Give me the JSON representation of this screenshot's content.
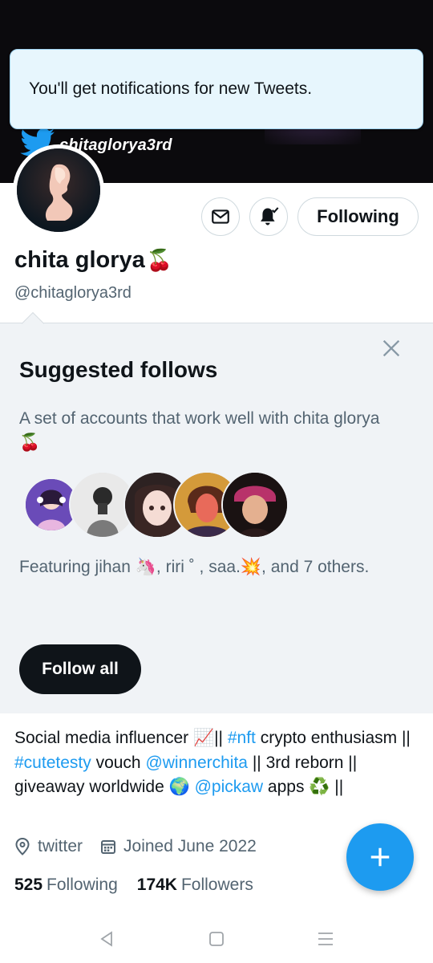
{
  "banner": {
    "handle_text": "chitaglorya3rd",
    "bird_color": "#1d9bf0"
  },
  "toast": {
    "message": "You'll get notifications for new Tweets."
  },
  "profile": {
    "name": "chita glorya",
    "name_emoji": "🍒",
    "handle": "@chitaglorya3rd",
    "following_button": "Following",
    "message_icon": "envelope-icon",
    "notifications_icon": "bell-check-icon"
  },
  "suggested": {
    "title": "Suggested follows",
    "description": "A set of accounts that work well with chita glorya🍒",
    "featuring": "Featuring jihan 🦄, riri ˚ , saa.💥, and 7 others.",
    "follow_all": "Follow all",
    "close_icon": "close-icon"
  },
  "bio": {
    "part1": "Social media influencer 📈|| ",
    "tag1": "#nft",
    "part2": " crypto enthusiasm || ",
    "tag2": "#cutetesty",
    "part3": " vouch ",
    "mention1": "@winnerchita",
    "part4": " || 3rd reborn || giveaway worldwide 🌍 ",
    "mention2": "@pickaw",
    "part5": " apps ♻️ ||"
  },
  "meta": {
    "location": "twitter",
    "joined": "Joined June 2022"
  },
  "counts": {
    "following_count": "525",
    "following_label": "Following",
    "followers_count": "174K",
    "followers_label": "Followers"
  },
  "colors": {
    "accent": "#1d9bf0",
    "text": "#0f1419",
    "muted": "#536471"
  }
}
